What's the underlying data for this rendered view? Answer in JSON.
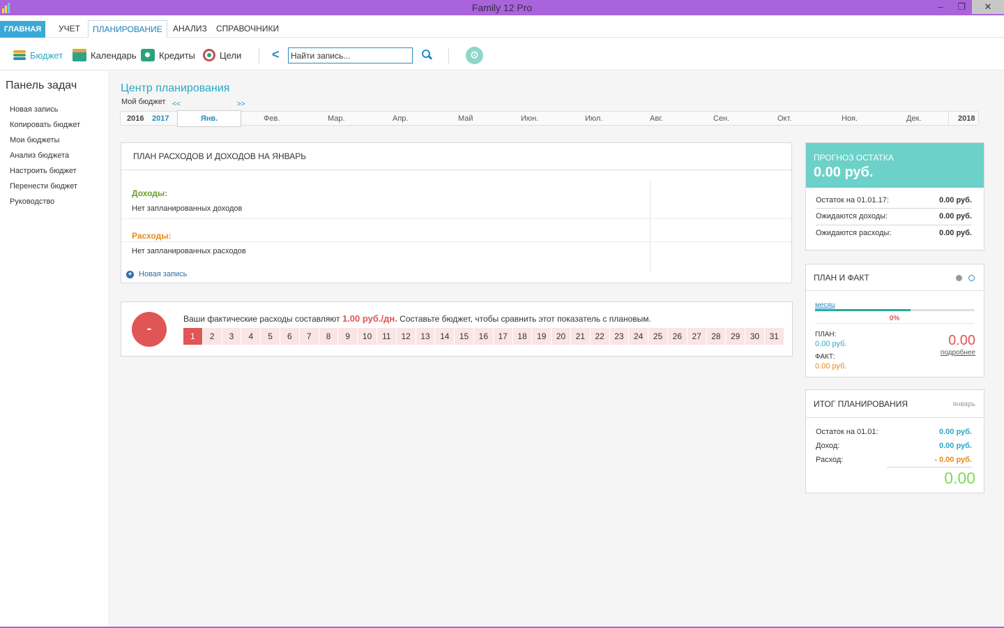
{
  "window": {
    "title": "Family 12 Pro",
    "minimize": "–",
    "restore": "❐",
    "close": "✕"
  },
  "menu": {
    "items": [
      {
        "label": "ГЛАВНАЯ"
      },
      {
        "label": "УЧЕТ"
      },
      {
        "label": "ПЛАНИРОВАНИЕ"
      },
      {
        "label": "АНАЛИЗ"
      },
      {
        "label": "СПРАВОЧНИКИ"
      }
    ],
    "active": "ПЛАНИРОВАНИЕ"
  },
  "toolbar": {
    "budget": "Бюджет",
    "calendar": "Календарь",
    "credits": "Кредиты",
    "goals": "Цели",
    "back": "<",
    "search_placeholder": "Найти запись...",
    "search_value": "Найти запись...",
    "gear": "⚙"
  },
  "sidebar": {
    "title": "Панель задач",
    "links": [
      "Новая запись",
      "Копировать бюджет",
      "Мои бюджеты",
      "Анализ бюджета",
      "Настроить бюджет",
      "Перенести бюджет",
      "Руководство"
    ]
  },
  "main": {
    "title": "Центр планирования",
    "budget_label": "Мой бюджет",
    "nav_prev": "<<",
    "nav_next": ">>",
    "year_prev": "2016",
    "year_cur": "2017",
    "year_next": "2018",
    "months": [
      "Янв.",
      "Фев.",
      "Мар.",
      "Апр.",
      "Май",
      "Июн.",
      "Июл.",
      "Авг.",
      "Сен.",
      "Окт.",
      "Ноя.",
      "Дек."
    ],
    "active_month": "Янв."
  },
  "plan": {
    "header": "ПЛАН РАСХОДОВ И ДОХОДОВ НА ЯНВАРЬ",
    "income_title": "Доходы:",
    "income_empty": "Нет запланированных доходов",
    "expense_title": "Расходы:",
    "expense_empty": "Нет запланированных расходов",
    "new_entry": "Новая запись",
    "plus": "+"
  },
  "actual": {
    "badge": "-",
    "text_before": "Ваши фактические расходы составляют ",
    "amount": "1.00 руб./дн.",
    "text_after": " Составьте бюджет, чтобы сравнить этот показатель с плановым.",
    "days": [
      "1",
      "2",
      "3",
      "4",
      "5",
      "6",
      "7",
      "8",
      "9",
      "10",
      "11",
      "12",
      "13",
      "14",
      "15",
      "16",
      "17",
      "18",
      "19",
      "20",
      "21",
      "22",
      "23",
      "24",
      "25",
      "26",
      "27",
      "28",
      "29",
      "30",
      "31"
    ],
    "active_day": "1"
  },
  "forecast": {
    "label": "ПРОГНОЗ ОСТАТКА",
    "value": "0.00 руб.",
    "rows": [
      {
        "k": "Остаток на 01.01.17:",
        "v": "0.00 руб."
      },
      {
        "k": "Ожидаются доходы:",
        "v": "0.00 руб."
      },
      {
        "k": "Ожидаются расходы:",
        "v": "0.00 руб."
      }
    ]
  },
  "plan_fact": {
    "title": "ПЛАН И ФАКТ",
    "period": "месяц",
    "progress": 0.6,
    "percent": "0%",
    "plan_label": "ПЛАН:",
    "plan_value": "0.00 руб.",
    "fact_label": "ФАКТ:",
    "fact_value": "0.00 руб.",
    "big_value": "0.00",
    "more": "подробнее"
  },
  "total": {
    "title": "ИТОГ ПЛАНИРОВАНИЯ",
    "month": "январь",
    "rows": [
      {
        "k": "Остаток на 01.01:",
        "v": "0.00 руб."
      },
      {
        "k": "Доход:",
        "v": "0.00 руб."
      },
      {
        "k": "Расход:",
        "v": "- 0.00 руб."
      }
    ],
    "value": "0.00"
  },
  "colors": {
    "title_bar": "#a964dc",
    "accent": "#2aa7c5",
    "forecast": "#6bd1c9",
    "alert": "#e05555",
    "income": "#6aa02e",
    "expense": "#e58a1a",
    "total": "#7ed957"
  }
}
